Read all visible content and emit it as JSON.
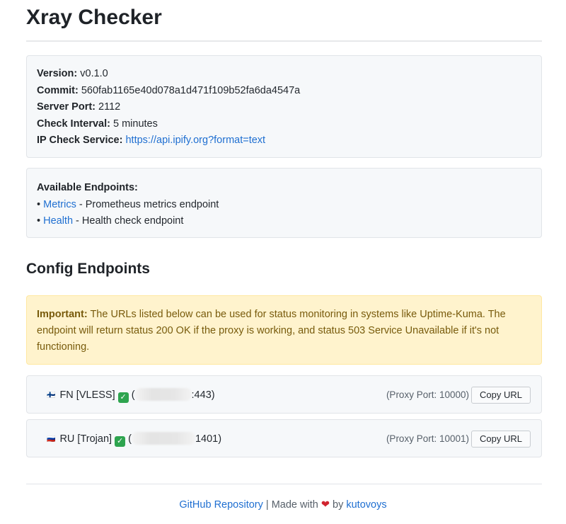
{
  "title": "Xray Checker",
  "info": {
    "version_label": "Version:",
    "version_value": "v0.1.0",
    "commit_label": "Commit:",
    "commit_value": "560fab1165e40d078a1d471f109b52fa6da4547a",
    "port_label": "Server Port:",
    "port_value": "2112",
    "interval_label": "Check Interval:",
    "interval_value": "5 minutes",
    "ipcheck_label": "IP Check Service:",
    "ipcheck_value": "https://api.ipify.org?format=text"
  },
  "endpoints": {
    "heading": "Available Endpoints:",
    "items": [
      {
        "bullet": "•",
        "link": "Metrics",
        "desc": " - Prometheus metrics endpoint"
      },
      {
        "bullet": "•",
        "link": "Health",
        "desc": " - Health check endpoint"
      }
    ]
  },
  "config": {
    "heading": "Config Endpoints",
    "warning_bold": "Important:",
    "warning_text": " The URLs listed below can be used for status monitoring in systems like Uptime-Kuma. The endpoint will return status 200 OK if the proxy is working, and status 503 Service Unavailable if it's not functioning."
  },
  "proxies": [
    {
      "flag": "🇫🇮",
      "name": "FN [VLESS]",
      "open": "(",
      "suffix": ":443)",
      "port": "(Proxy Port: 10000)",
      "copy_label": "Copy URL",
      "status_icon": "check-mark-icon",
      "status_char": "✓"
    },
    {
      "flag": "🇷🇺",
      "name": "RU [Trojan]",
      "open": "(",
      "suffix": "1401)",
      "port": "(Proxy Port: 10001)",
      "copy_label": "Copy URL",
      "status_icon": "check-mark-icon",
      "status_char": "✓"
    }
  ],
  "footer": {
    "github": "GitHub Repository",
    "sep": " | Made with ",
    "heart": "❤",
    "by": " by ",
    "author": "kutovoys"
  },
  "colors": {
    "link": "#1f6fd1",
    "warning_bg": "#fff3cd",
    "warning_text": "#785b0c",
    "check_green": "#2ea44f"
  }
}
